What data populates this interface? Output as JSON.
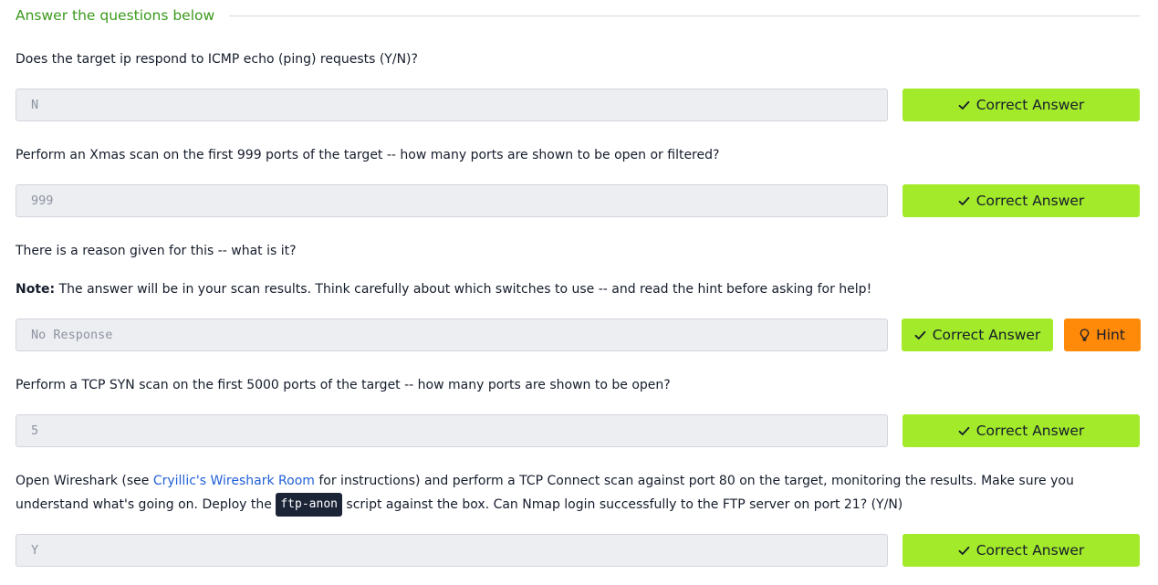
{
  "section": {
    "title": "Answer the questions below"
  },
  "questions": [
    {
      "text": "Does the target ip respond to ICMP echo (ping) requests (Y/N)?",
      "answer": "N",
      "button_label": "Correct Answer"
    },
    {
      "text": "Perform an Xmas scan on the first 999 ports of the target -- how many ports are shown to be open or filtered?",
      "answer": "999",
      "button_label": "Correct Answer"
    },
    {
      "text": "There is a reason given for this -- what is it?",
      "note_label": "Note:",
      "note_text": " The answer will be in your scan results. Think carefully about which switches to use -- and read the hint before asking for help!",
      "answer": "No Response",
      "button_label": "Correct Answer",
      "hint_label": "Hint"
    },
    {
      "text": "Perform a TCP SYN scan on the first 5000 ports of the target -- how many ports are shown to be open?",
      "answer": "5",
      "button_label": "Correct Answer"
    },
    {
      "text_before_link": "Open Wireshark (see ",
      "link_text": "Cryillic's Wireshark Room",
      "text_after_link": " for instructions) and perform a TCP Connect scan against port 80 on the target, monitoring the results. Make sure you understand what's going on. Deploy the ",
      "code_text": "ftp-anon",
      "text_after_code": " script against the box. Can Nmap login successfully to the FTP server on port 21? (Y/N)",
      "answer": "Y",
      "button_label": "Correct Answer"
    }
  ],
  "icons": {
    "correct": "check-icon",
    "hint": "lightbulb-icon"
  },
  "colors": {
    "header_green": "#3a9a1c",
    "correct_button": "#a3ea2a",
    "hint_button": "#ff8a0a",
    "link": "#1f5fd6",
    "code_bg": "#1c2538"
  }
}
